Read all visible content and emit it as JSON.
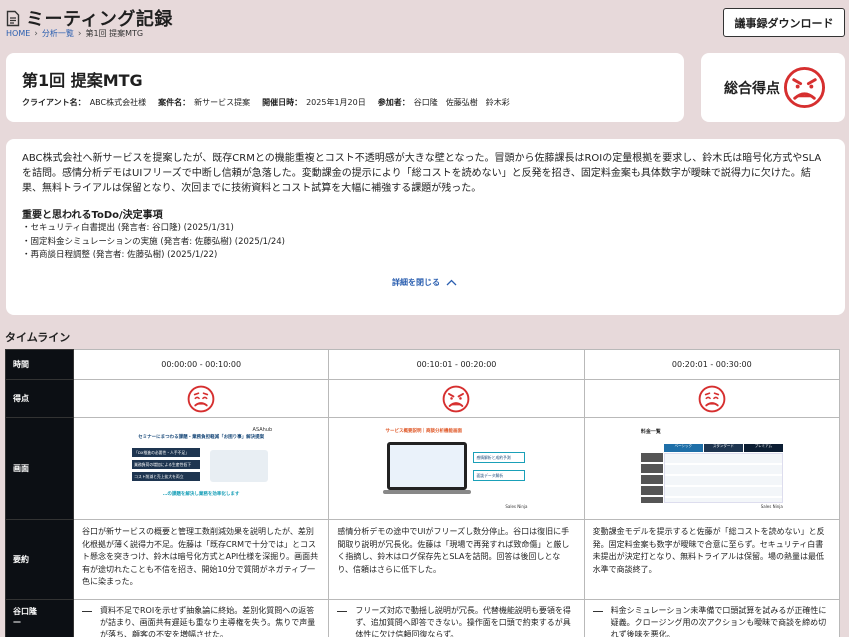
{
  "header": {
    "title": "ミーティング記録",
    "breadcrumb": {
      "home": "HOME",
      "analysis": "分析一覧",
      "current": "第1回 提案MTG"
    },
    "download_label": "議事録ダウンロード"
  },
  "meeting": {
    "title": "第1回 提案MTG",
    "client_label": "クライアント名：",
    "client": "ABC株式会社様",
    "project_label": "案件名：",
    "project": "新サービス提案",
    "date_label": "開催日時：",
    "date": "2025年1月20日",
    "participants_label": "参加者：",
    "participants": "谷口隆　佐藤弘樹　鈴木彩"
  },
  "score": {
    "label": "総合得点",
    "face": "angry-face-icon",
    "color": "#d62f2f"
  },
  "summary": {
    "text": "ABC株式会社へ新サービスを提案したが、既存CRMとの機能重複とコスト不透明感が大きな壁となった。冒頭から佐藤課長はROIの定量根拠を要求し、鈴木氏は暗号化方式やSLAを詰問。感情分析デモはUIフリーズで中断し信頼が急落した。変動課金の提示により「総コストを読めない」と反発を招き、固定料金案も具体数字が曖昧で説得力に欠けた。結果、無料トライアルは保留となり、次回までに技術資料とコスト試算を大幅に補強する課題が残った。",
    "todo_heading": "重要と思われるToDo/決定事項",
    "todos": [
      "セキュリティ白書提出 (発言者: 谷口隆) (2025/1/31)",
      "固定料金シミュレーションの実施 (発言者: 佐藤弘樹) (2025/1/24)",
      "再商談日程調整 (発言者: 佐藤弘樹) (2025/1/22)"
    ],
    "collapse_label": "詳細を閉じる"
  },
  "timeline": {
    "heading": "タイムライン",
    "row_labels": {
      "time": "時間",
      "score": "得点",
      "screen": "画面",
      "summary": "要約",
      "speaker": "谷口隆"
    },
    "speaker_dash": "—",
    "segments": [
      {
        "time": "00:00:00 - 00:10:00",
        "face": "worried-face-icon",
        "summary": "谷口が新サービスの概要と管理工数削減効果を説明したが、差別化根拠が薄く説得力不足。佐藤は「既存CRMで十分では」とコスト懸念を突きつけ、鈴木は暗号化方式とAPI仕様を深掘り。画面共有が途切れたことも不信を招き、開始10分で質問がネガティブ一色に染まった。",
        "speaker_text": "資料不足でROIを示せず抽象論に終始。差別化質問への返答が詰まり、画面共有遅延も重なり主導権を失う。焦りで声量が落ち、顧客の不安を増幅させた。",
        "slide": {
          "title": "セミナーにまつわる課題・業務負担軽減「お困り事」解決提案",
          "items": [
            "「DX推進の必要性・人手不足」",
            "業務負荷の増加による生産性低下",
            "コスト削減と売上拡大を両立"
          ],
          "footer": "…の課題を解決し業務を効率化します",
          "brand": "ASAhub"
        }
      },
      {
        "time": "00:10:01 - 00:20:00",
        "face": "angry-face-icon",
        "summary": "感情分析デモの途中でUIがフリーズし数分停止。谷口は復旧に手間取り説明が冗長化。佐藤は「現場で再発すれば致命傷」と厳しく指摘し、鈴木はログ保存先とSLAを詰問。回答は後回しとなり、信頼はさらに低下した。",
        "speaker_text": "フリーズ対応で動揺し説明が冗長。代替機能説明も要領を得ず、追加質問へ即答できない。操作面を口頭で約束するが具体性に欠け信頼回復ならず。",
        "slide": {
          "title": "サービス概要説明｜商談分析機能画面",
          "items": [
            "感情解析と成約予測",
            "面談データ解析"
          ],
          "footer": "",
          "brand": "Sales Ninja"
        }
      },
      {
        "time": "00:20:01 - 00:30:00",
        "face": "worried-face-icon",
        "summary": "変動課金モデルを提示すると佐藤が「総コストを読めない」と反発。固定料金案も数字が曖昧で合意に至らず。セキュリティ白書未提出が決定打となり、無料トライアルは保留。場の熱量は最低水準で商談終了。",
        "speaker_text": "料金シミュレーション未準備で口頭試算を試みるが正確性に疑義。クロージング用の次アクションも曖昧で商談を締め切れず後味を悪化。",
        "slide": {
          "title": "料金一覧",
          "items": [
            "ベーシック",
            "スタンダード",
            "プレミアム"
          ],
          "footer": "",
          "brand": "Sales Ninja"
        }
      }
    ]
  }
}
